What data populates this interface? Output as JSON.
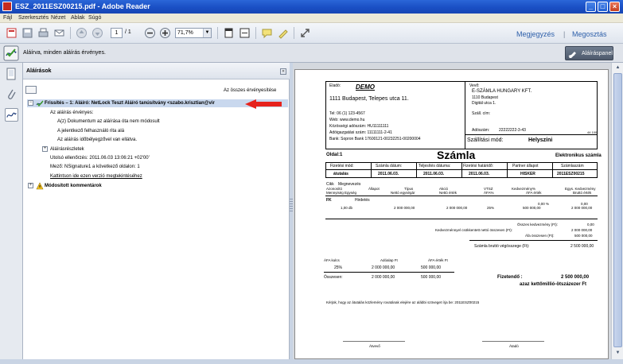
{
  "window": {
    "title": "ESZ_2011ESZ00215.pdf - Adobe Reader",
    "minimize": "_",
    "maximize": "□",
    "close": "×"
  },
  "menu": [
    "Fájl",
    "Szerkesztés",
    "Nézet",
    "Ablak",
    "Súgó"
  ],
  "toolbar": {
    "page_current": "1",
    "page_total": "/ 1",
    "zoom": "71,7%",
    "comment_link": "Megjegyzés",
    "share_link": "Megosztás"
  },
  "signature_bar": {
    "message": "Aláírva, minden aláírás érvényes.",
    "panel_button": "Aláíráspanel"
  },
  "signatures_panel": {
    "title": "Aláírások",
    "close": "«",
    "verify_all": "Az összes érvényesítése",
    "tree": {
      "revision": "Frissítés – 1: Aláíró: NetLock Teszt Aláíró tanúsítvány <szabo.krisztian@vir",
      "valid": "Az aláírás érvényes:",
      "item1": "A(z) Dokumentum az aláírása óta nem módosult",
      "item2": "A jelentkező felhasználó rita alá",
      "item3": "Az aláírás időbélyegzővel van ellátva.",
      "details": "Aláírásrészletek",
      "last_checked": "Utolsó ellenőrzés: 2011.06.03 13:06:21 +02'00'",
      "field": "Mező: NSignature1 a következő oldalon: 1",
      "click_link": "Kattintson ide ezen verzió megtekintéséhez",
      "modified_comments": "Módosított kommentárok"
    }
  },
  "invoice": {
    "seller_label": "Eladó:",
    "seller_name": "DEMO",
    "seller_address": "1111 Budapest, Telepes utca 11.",
    "seller_tel": "Tel: 06 (1) 123-4567",
    "seller_web": "Web: www.demo.hu",
    "seller_eu_tax": "Közösségi adószám: HU11111111",
    "seller_tax": "Adóigazgatási szám: 11111111-2-41",
    "seller_bank": "Bank: Sopron Bank   17600121-00232251-00200004",
    "buyer_label": "Vevő:",
    "buyer_name": "E-SZÁMLA HUNGARY KFT.",
    "buyer_city": "1110 Budapest",
    "buyer_street": "Digitál utca 1.",
    "ship_addr": "Száll. cím:",
    "buyer_tax_label": "Adószám:",
    "buyer_tax": "22222222-3-43",
    "ship_mode_label": "Szállítási mód:",
    "ship_mode": "Helyszíni",
    "small_code": "44 100",
    "page_label": "Oldal:1",
    "doc_title": "Számla",
    "doc_type": "Elektronikus számla",
    "h_payment": "Fizetési mód:",
    "h_invoice_date": "Számla dátum:",
    "h_fulfilment": "Teljesítés dátuma:",
    "h_due": "Fizetési határidő:",
    "h_partner": "Partner állapot",
    "h_number": "Számlaszám",
    "v_payment": "átutalás",
    "v_invoice_date": "2011.06.03.",
    "v_fulfilment": "2011.06.03.",
    "v_due": "2011.06.03.",
    "v_partner": "HISKER",
    "v_number": "2011ESZ00215",
    "c_item": "Cikk",
    "c_name": "Megnevezés",
    "c_id": "Azonosító",
    "c_state": "Állapot",
    "c_type": "Típus",
    "c_unit_price": "Akció",
    "c_vtsz": "VTSZ",
    "c_discount": "Kedvezmény%",
    "c_unit_gross": "Egys. Kedvezmény",
    "c_qty": "Mennyiség Egység",
    "c_net_unit": "Nettó egységár",
    "c_net_value": "Nettó érték",
    "c_vat": "ÁFA%",
    "c_vat_value": "ÁFA érték",
    "c_gross": "Bruttó érték",
    "row_code": "FK",
    "row_name": "Hirdetés",
    "row_disc": "0,00 %",
    "row_disc2": "0,00",
    "row_qty": "1,00 db",
    "row_net_unit": "2 000 000,00",
    "row_net_value": "2 000 000,00",
    "row_vat": "25%",
    "row_vat_value": "500 000,00",
    "row_gross": "2 000 000,00",
    "sum_discount_label": "Összes kedvezmény (Ft):",
    "sum_discount": "0,00",
    "sum_net_label": "Kedvezménnyel csökkentett nettó összesen (Ft):",
    "sum_net": "2 000 000,00",
    "sum_vat_label": "Áfa összesen (Ft):",
    "sum_vat": "500 000,00",
    "sum_gross_label": "Számla bruttó végösszege (Ft):",
    "sum_gross": "2 500 000,00",
    "vat_key": "ÁFA kulcs",
    "tax_base": "Adóalap Ft",
    "vat_amount": "ÁFA érték Ft",
    "vat_row_rate": "25%",
    "vat_row_base": "2 000 000,00",
    "vat_row_amount": "500 000,00",
    "total_label": "Összesen:",
    "total_base": "2 000 000,00",
    "total_vat": "500 000,00",
    "pay_label": "Fizetendő :",
    "pay_amount": "2 500 000,00",
    "pay_words": "azaz kettőmillió-ötszázezer Ft",
    "note": "Kérjük, hogy az átutalás közlemény rovatának elejére az alábbi szöveget írja be: 2011ESZ00215",
    "sign_receiver": "Átvevő",
    "sign_issuer": "Átadó"
  }
}
